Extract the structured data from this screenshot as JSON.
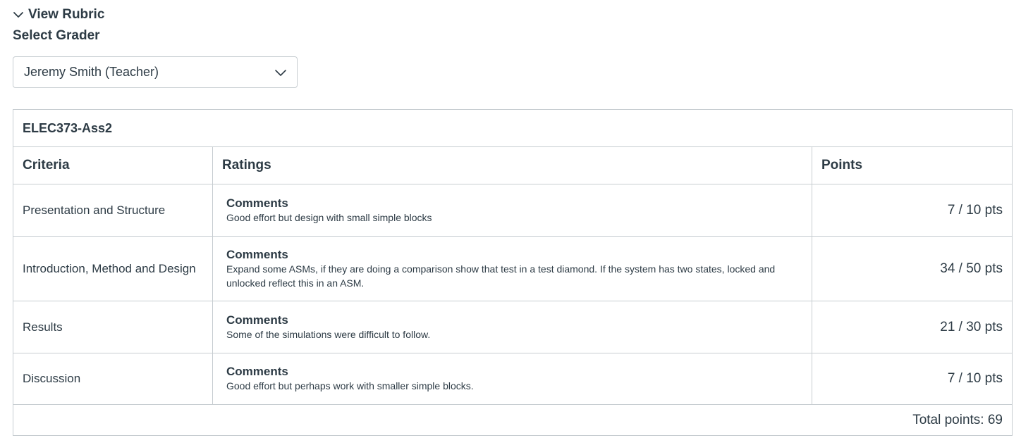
{
  "rubric_toggle": {
    "label": "View Rubric",
    "icon": "chevron-down-icon"
  },
  "grader": {
    "label": "Select Grader",
    "selected": "Jeremy Smith (Teacher)",
    "icon": "chevron-down-icon"
  },
  "rubric": {
    "title": "ELEC373-Ass2",
    "headers": {
      "criteria": "Criteria",
      "ratings": "Ratings",
      "points": "Points"
    },
    "rows": [
      {
        "criteria": "Presentation and Structure",
        "rating_title": "Comments",
        "rating_text": "Good effort but design with small simple blocks",
        "points": "7 / 10 pts"
      },
      {
        "criteria": "Introduction, Method and Design",
        "rating_title": "Comments",
        "rating_text": "Expand some ASMs, if they are doing a comparison show that test in a test diamond. If the system has two states, locked and unlocked reflect this in an ASM.",
        "points": "34 / 50 pts"
      },
      {
        "criteria": "Results",
        "rating_title": "Comments",
        "rating_text": "Some of the simulations were difficult to follow.",
        "points": "21 / 30 pts"
      },
      {
        "criteria": "Discussion",
        "rating_title": "Comments",
        "rating_text": "Good effort but perhaps work with smaller simple blocks.",
        "points": "7 / 10 pts"
      }
    ],
    "total": "Total points: 69"
  },
  "colors": {
    "text": "#2d3b45",
    "border": "#c7cdd1",
    "background": "#ffffff"
  }
}
